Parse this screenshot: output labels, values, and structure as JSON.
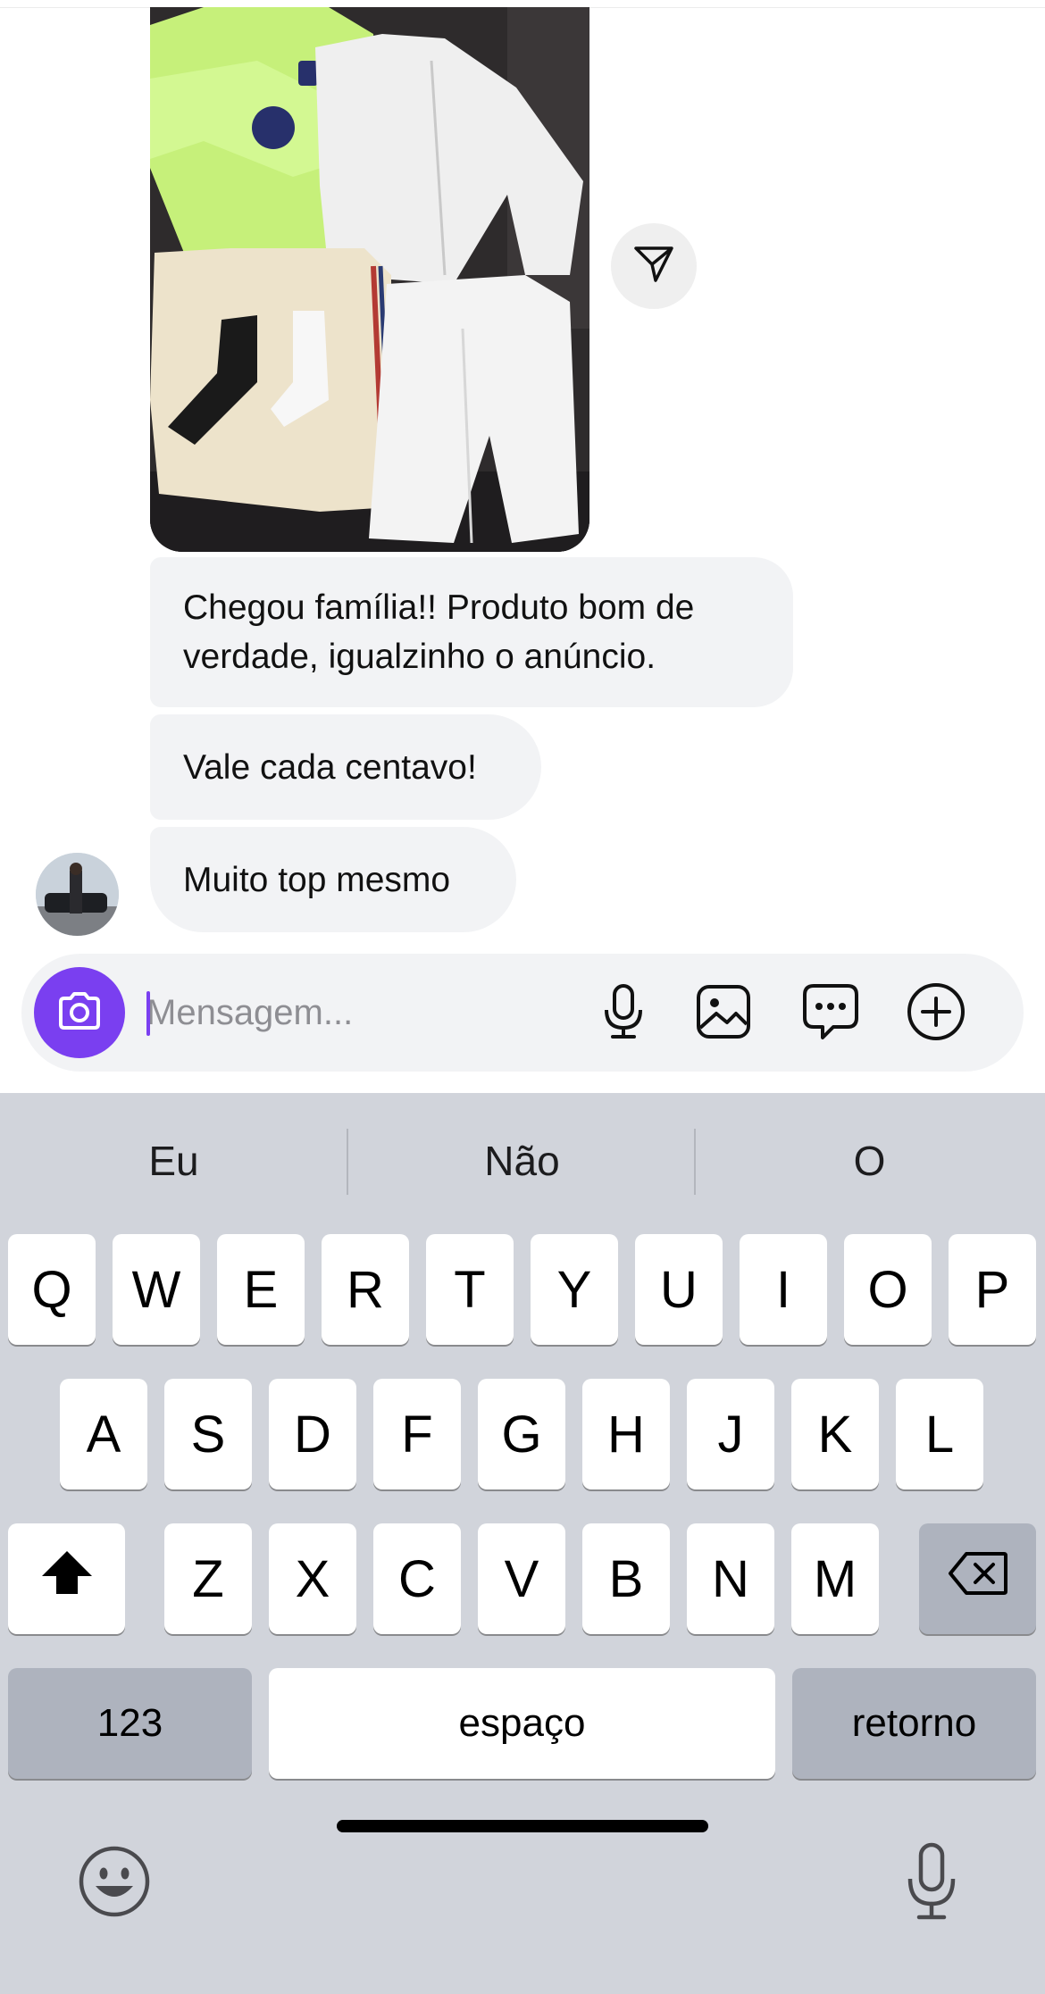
{
  "messages": [
    {
      "text": "Chegou família!! Produto bom de verdade, igualzinho o anúncio."
    },
    {
      "text": "Vale cada centavo!"
    },
    {
      "text": "Muito top mesmo"
    }
  ],
  "composer": {
    "placeholder": "Mensagem...",
    "value": "",
    "icons": [
      "camera-icon",
      "microphone-icon",
      "gallery-icon",
      "sticker-icon",
      "plus-icon"
    ],
    "accent": "#7a3ff0"
  },
  "keyboard": {
    "suggestions": [
      "Eu",
      "Não",
      "O"
    ],
    "row1": [
      "Q",
      "W",
      "E",
      "R",
      "T",
      "Y",
      "U",
      "I",
      "O",
      "P"
    ],
    "row2": [
      "A",
      "S",
      "D",
      "F",
      "G",
      "H",
      "J",
      "K",
      "L"
    ],
    "row3": [
      "Z",
      "X",
      "C",
      "V",
      "B",
      "N",
      "M"
    ],
    "numbers_label": "123",
    "space_label": "espaço",
    "return_label": "retorno",
    "icons": [
      "shift-icon",
      "backspace-icon",
      "emoji-icon",
      "dictation-icon"
    ]
  }
}
